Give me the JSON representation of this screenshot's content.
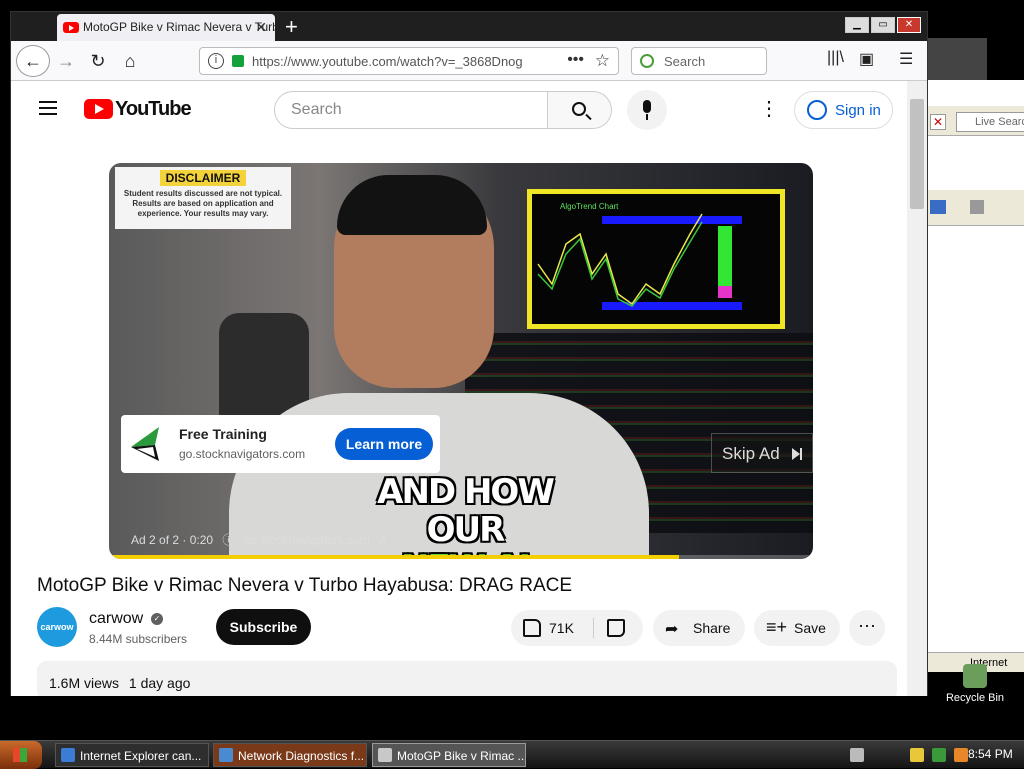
{
  "browser": {
    "tab_title": "MotoGP Bike v Rimac Nevera v Turbo Hayabusa: DRAG RACE",
    "url": "https://www.youtube.com/watch?v=_3868Dnog",
    "search_placeholder": "Search"
  },
  "background_window": {
    "live_search_placeholder": "Live Search",
    "status_text": "Internet"
  },
  "desktop": {
    "recycle_bin_label": "Recycle Bin"
  },
  "youtube": {
    "logo_text": "YouTube",
    "search_placeholder": "Search",
    "sign_in_label": "Sign in"
  },
  "ad": {
    "disclaimer_heading": "DISCLAIMER",
    "disclaimer_text": "Student results discussed are not typical. Results are based on application and experience. Your results may vary.",
    "chart_title": "AlgoTrend Chart",
    "caption_line1": "AND HOW OUR",
    "caption_line2": "NEW AI TOOL",
    "card_title": "Free Training",
    "card_domain": "go.stocknavigators.com",
    "learn_more_label": "Learn more",
    "skip_label": "Skip Ad",
    "ad_info": "Ad 2 of 2 · 0:20",
    "ad_info_domain": "go.stocknavigators.com",
    "progress": 0.81
  },
  "video": {
    "title": "MotoGP Bike v Rimac Nevera v Turbo Hayabusa: DRAG RACE",
    "channel_name": "carwow",
    "channel_avatar_text": "carwow",
    "subscribers": "8.44M subscribers",
    "subscribe_label": "Subscribe",
    "likes": "71K",
    "share_label": "Share",
    "save_label": "Save",
    "views": "1.6M views",
    "age": "1 day ago"
  },
  "taskbar": {
    "tasks": [
      {
        "label": "Internet Explorer can...",
        "color": "#3a7cd6"
      },
      {
        "label": "Network Diagnostics f...",
        "color": "#4a8ad0"
      },
      {
        "label": "MotoGP Bike v Rimac ...",
        "color": "#c8c8c8"
      }
    ],
    "clock": "8:54 PM"
  },
  "colors": {
    "youtube_red": "#ff0000",
    "learn_more_blue": "#065fd4",
    "ad_progress_yellow": "#f4cf00",
    "caption_green": "#6ff03a"
  }
}
